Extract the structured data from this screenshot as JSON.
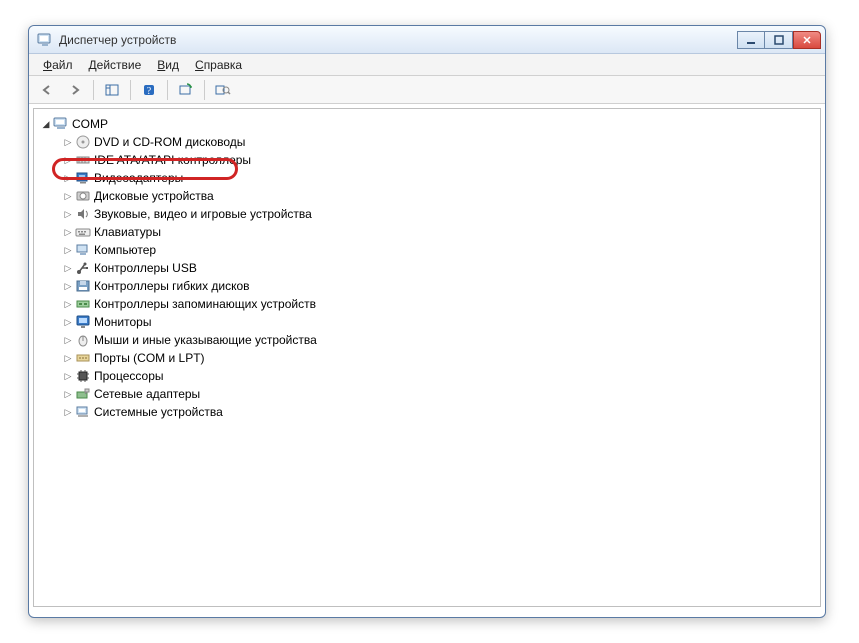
{
  "titlebar": {
    "title": "Диспетчер устройств"
  },
  "menu": {
    "file_u": "Ф",
    "file_r": "айл",
    "action_u": "Д",
    "action_r": "ействие",
    "view_u": "В",
    "view_r": "ид",
    "help_u": "С",
    "help_r": "правка"
  },
  "tree": {
    "root": {
      "label": "COMP",
      "icon": "computer-icon",
      "expanded": true
    },
    "children": [
      {
        "label": "DVD и CD-ROM дисководы",
        "icon": "disc-icon"
      },
      {
        "label": "IDE ATA/ATAPI контроллеры",
        "icon": "ide-icon"
      },
      {
        "label": "Видеоадаптеры",
        "icon": "display-adapter-icon",
        "highlighted": true
      },
      {
        "label": "Дисковые устройства",
        "icon": "disk-drive-icon"
      },
      {
        "label": "Звуковые, видео и игровые устройства",
        "icon": "sound-icon"
      },
      {
        "label": "Клавиатуры",
        "icon": "keyboard-icon"
      },
      {
        "label": "Компьютер",
        "icon": "computer-small-icon"
      },
      {
        "label": "Контроллеры USB",
        "icon": "usb-icon"
      },
      {
        "label": "Контроллеры гибких дисков",
        "icon": "floppy-controller-icon"
      },
      {
        "label": "Контроллеры запоминающих устройств",
        "icon": "storage-controller-icon"
      },
      {
        "label": "Мониторы",
        "icon": "monitor-icon"
      },
      {
        "label": "Мыши и иные указывающие устройства",
        "icon": "mouse-icon"
      },
      {
        "label": "Порты (COM и LPT)",
        "icon": "port-icon"
      },
      {
        "label": "Процессоры",
        "icon": "cpu-icon"
      },
      {
        "label": "Сетевые адаптеры",
        "icon": "network-icon"
      },
      {
        "label": "Системные устройства",
        "icon": "system-icon"
      }
    ]
  }
}
